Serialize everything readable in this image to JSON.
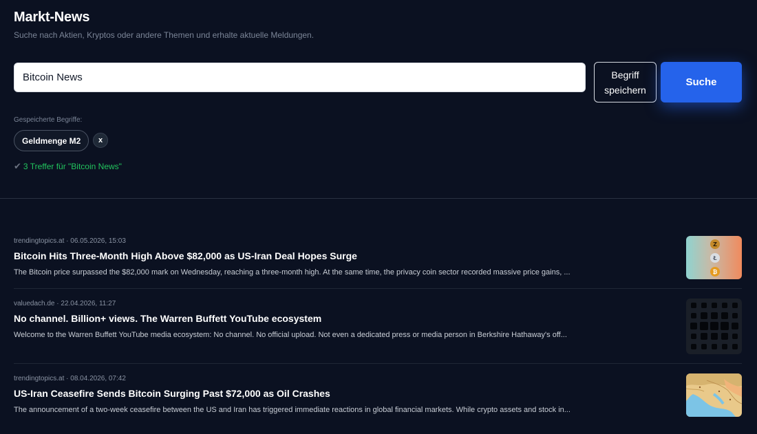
{
  "header": {
    "title": "Markt-News",
    "subtitle": "Suche nach Aktien, Kryptos oder andere Themen und erhalte aktuelle Meldungen."
  },
  "search": {
    "value": "Bitcoin News",
    "save_label": "Begriff speichern",
    "submit_label": "Suche"
  },
  "saved": {
    "label": "Gespeicherte Begriffe:",
    "terms": [
      {
        "label": "Geldmenge M2",
        "remove_label": "x"
      }
    ]
  },
  "results": {
    "summary": "3 Treffer für \"Bitcoin News\"",
    "check_glyph": "✔"
  },
  "news": [
    {
      "meta": "trendingtopics.at · 06.05.2026, 15:03",
      "title": "Bitcoin Hits Three-Month High Above $82,000 as US-Iran Deal Hopes Surge",
      "snippet": "The Bitcoin price surpassed the $82,000 mark on Wednesday, reaching a three-month high. At the same time, the privacy coin sector recorded massive price gains, ...",
      "thumb_icon": "crypto-coins-thumbnail"
    },
    {
      "meta": "valuedach.de · 22.04.2026, 11:27",
      "title": "No channel. Billion+ views. The Warren Buffett YouTube ecosystem",
      "snippet": "Welcome to the Warren Buffett YouTube media ecosystem: No channel. No official upload. Not even a dedicated press or media person in Berkshire Hathaway's off...",
      "thumb_icon": "dot-grid-thumbnail"
    },
    {
      "meta": "trendingtopics.at · 08.04.2026, 07:42",
      "title": "US-Iran Ceasefire Sends Bitcoin Surging Past $72,000 as Oil Crashes",
      "snippet": "The announcement of a two-week ceasefire between the US and Iran has triggered immediate reactions in global financial markets. While crypto assets and stock in...",
      "thumb_icon": "map-thumbnail"
    }
  ],
  "colors": {
    "background": "#0b1121",
    "accent": "#2563eb",
    "success": "#22c55e"
  }
}
